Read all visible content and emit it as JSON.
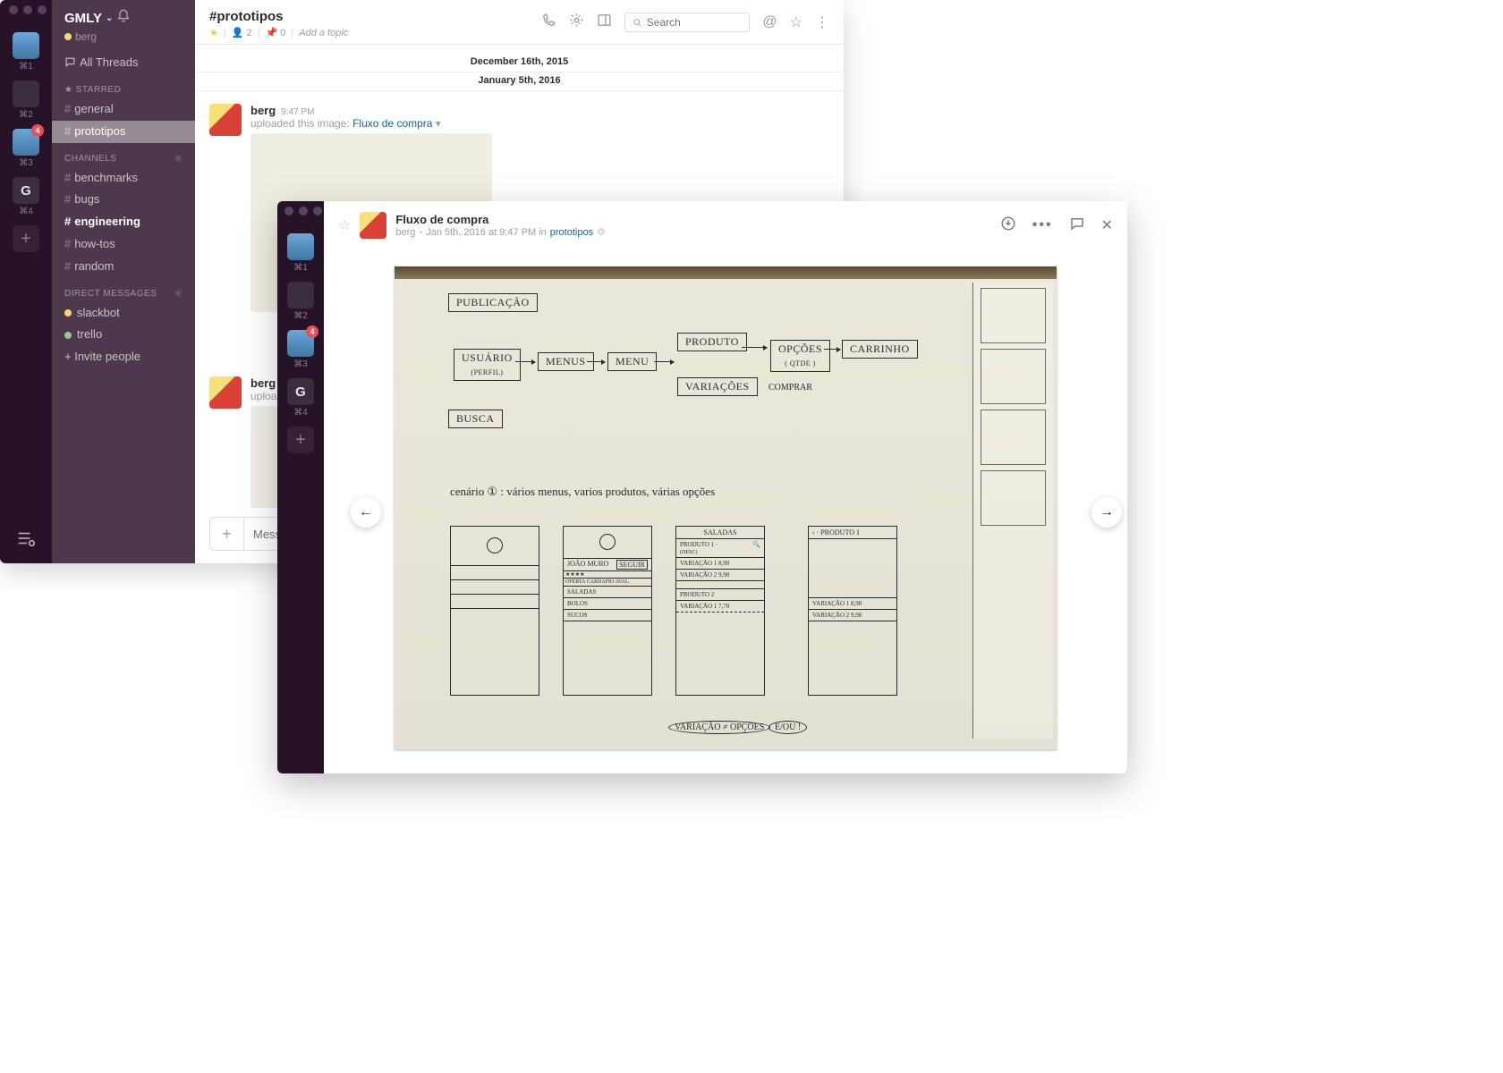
{
  "workspace": {
    "name": "GMLY",
    "user": "berg"
  },
  "rail": {
    "items": [
      {
        "shortcut": "⌘1",
        "badge": null
      },
      {
        "shortcut": "⌘2",
        "badge": null
      },
      {
        "shortcut": "⌘3",
        "badge": "4"
      },
      {
        "shortcut": "⌘4",
        "badge": null,
        "letter": "G"
      }
    ]
  },
  "sidebar": {
    "all_threads": "All Threads",
    "starred_label": "STARRED",
    "starred": [
      {
        "name": "general"
      },
      {
        "name": "prototipos",
        "active": true
      }
    ],
    "channels_label": "CHANNELS",
    "channels": [
      {
        "name": "benchmarks"
      },
      {
        "name": "bugs"
      },
      {
        "name": "engineering",
        "bold": true
      },
      {
        "name": "how-tos"
      },
      {
        "name": "random"
      }
    ],
    "dms_label": "DIRECT MESSAGES",
    "dms": [
      {
        "name": "slackbot",
        "presence": "y"
      },
      {
        "name": "trello",
        "presence": "g"
      }
    ],
    "invite": "Invite people"
  },
  "header": {
    "channel": "#prototipos",
    "members": "2",
    "members_icon_prefix": "👥",
    "pins": "0",
    "pins_icon_prefix": "📌",
    "topic_placeholder": "Add a topic",
    "search_placeholder": "Search"
  },
  "dates": {
    "d1": "December 16th, 2015",
    "d2": "January 5th, 2016"
  },
  "messages": [
    {
      "user": "berg",
      "time": "9:47 PM",
      "prefix": "uploaded this image: ",
      "link": "Fluxo de compra",
      "caret": "▾"
    },
    {
      "user": "berg",
      "time": "",
      "prefix": "uploa",
      "link": "",
      "caret": ""
    }
  ],
  "composer": {
    "placeholder": "Mess"
  },
  "modal": {
    "title": "Fluxo de compra",
    "author": "berg",
    "meta": "Jan 5th, 2016 at 9:47 PM in",
    "channel": "prototipos",
    "gear": "⚙"
  },
  "sketch": {
    "top_boxes": {
      "publicacao": "PUBLICAÇÃO",
      "usuario": "USUÁRIO",
      "usuario_sub": "(PERFIL)",
      "menus": "MENUS",
      "menu": "MENU",
      "produto": "PRODUTO",
      "variacoes": "VARIAÇÕES",
      "opcoes": "OPÇÕES",
      "opcoes_sub": "( QTDE )",
      "carrinho": "CARRINHO",
      "busca": "BUSCA",
      "comprar": "COMPRAR"
    },
    "scenario": "cenário ① : vários menus, varios produtos, várias opções",
    "phones": {
      "p2_name": "JOÃO MURO",
      "p2_rating": "★★★★",
      "p2_btn": "SEGUIR",
      "p2_tabs": "OFERTA  CARDÁPIO  AVAL.",
      "p2_r1": "SALADAS",
      "p2_r2": "BOLOS",
      "p2_r3": "SUCOS",
      "p3_head": "SALADAS",
      "p3_r1a": "PRODUTO 1",
      "p3_r1b": "(DESC)",
      "p3_r2": "VARIAÇÃO 1   8,90",
      "p3_r3": "VARIAÇÃO 2   9,90",
      "p3_r4": "PRODUTO 2",
      "p3_r5": "VARIAÇÃO 1   7,70",
      "p4_head": "‹  ·  PRODUTO 1",
      "p4_r1": "VARIAÇÃO 1   8,90",
      "p4_r2": "VARIAÇÃO 2   9,90"
    },
    "footer1": "VARIAÇÃO ≠ OPÇÕES",
    "footer2": "E/OU !"
  }
}
